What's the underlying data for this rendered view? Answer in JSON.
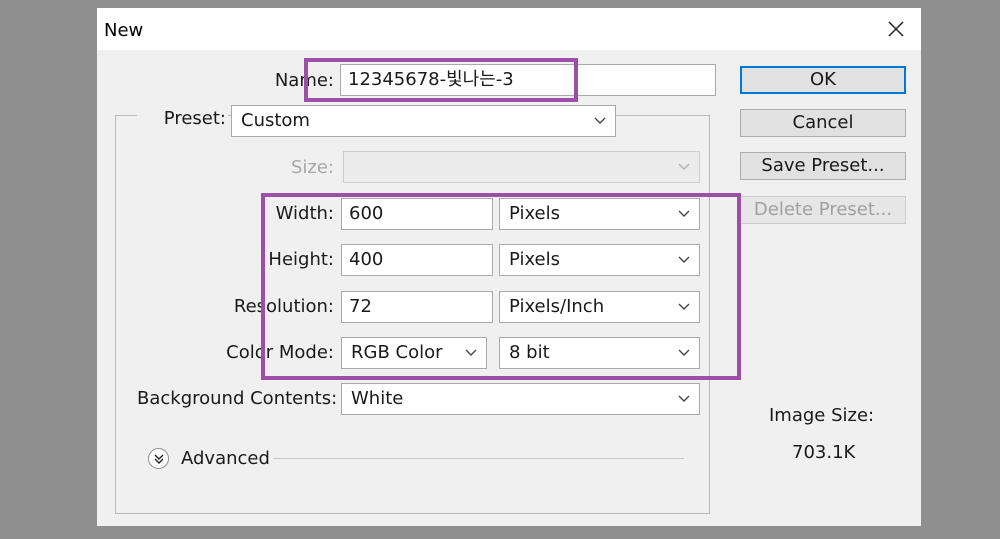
{
  "window": {
    "title": "New"
  },
  "form": {
    "name_label": "Name:",
    "name_value": "12345678-빛나는-3",
    "preset_label": "Preset:",
    "preset_value": "Custom",
    "size_label": "Size:",
    "size_value": "",
    "width_label": "Width:",
    "width_value": "600",
    "width_unit": "Pixels",
    "height_label": "Height:",
    "height_value": "400",
    "height_unit": "Pixels",
    "resolution_label": "Resolution:",
    "resolution_value": "72",
    "resolution_unit": "Pixels/Inch",
    "color_mode_label": "Color Mode:",
    "color_mode_value": "RGB Color",
    "bit_depth_value": "8 bit",
    "background_label": "Background Contents:",
    "background_value": "White",
    "advanced_label": "Advanced"
  },
  "buttons": {
    "ok": "OK",
    "cancel": "Cancel",
    "save_preset": "Save Preset...",
    "delete_preset": "Delete Preset..."
  },
  "info": {
    "image_size_label": "Image Size:",
    "image_size_value": "703.1K"
  },
  "colors": {
    "highlight": "#9b4fa6",
    "ok_border": "#0078d7",
    "backdrop": "#8f8f8f"
  }
}
